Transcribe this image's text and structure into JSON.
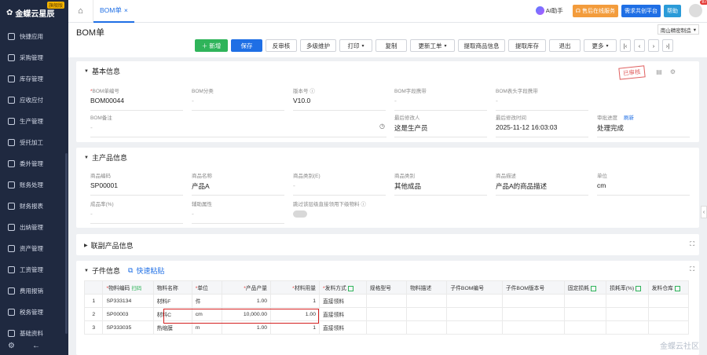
{
  "app": {
    "logo_text": "金蝶云星辰",
    "edition_badge": "旗舰版"
  },
  "sidebar": {
    "items": [
      {
        "label": "快捷应用"
      },
      {
        "label": "采购管理"
      },
      {
        "label": "库存管理"
      },
      {
        "label": "应收应付"
      },
      {
        "label": "生产管理"
      },
      {
        "label": "受托加工"
      },
      {
        "label": "委外管理"
      },
      {
        "label": "账务处理"
      },
      {
        "label": "财务报表"
      },
      {
        "label": "出纳管理"
      },
      {
        "label": "资产管理"
      },
      {
        "label": "工资管理"
      },
      {
        "label": "费用报销"
      },
      {
        "label": "税务管理"
      },
      {
        "label": "基础资料"
      }
    ]
  },
  "tabs": {
    "doc_tab": "BOM单"
  },
  "topbar": {
    "ai_label": "AI助手",
    "service_label": "售后在线服务",
    "demand_label": "需求共创平台",
    "help_label": "帮助",
    "notice_count": "87"
  },
  "page": {
    "title": "BOM单",
    "org": "南山精密制造"
  },
  "toolbar": {
    "new": "新增",
    "save": "保存",
    "unaudit": "反审核",
    "multi": "多级维护",
    "print": "打印",
    "copy": "复制",
    "update": "更新工单",
    "fetch_info": "提取商品信息",
    "fetch_stock": "提取库存",
    "exit": "退出",
    "more": "更多"
  },
  "basic": {
    "title": "基本信息",
    "stamp": "已审核",
    "bom_no_label": "BOM单编号",
    "bom_no": "BOM00044",
    "bom_cat_label": "BOM分类",
    "bom_cat": "-",
    "version_label": "版本号",
    "version": "V10.0",
    "field_carry_label": "BOM字段携带",
    "field_carry": "-",
    "head_carry_label": "BOM表头字段携带",
    "head_carry": "-",
    "remark_label": "BOM备注",
    "remark": "-",
    "modifier_label": "最后修改人",
    "modifier": "这是生产员",
    "modtime_label": "最后修改时间",
    "modtime": "2025-11-12 16:03:03",
    "approval_label": "审批进度",
    "refresh": "刷新",
    "approval": "处理完成"
  },
  "main_product": {
    "title": "主产品信息",
    "code_label": "商品编码",
    "code": "SP00001",
    "name_label": "商品名称",
    "name": "产品A",
    "cat_e_label": "商品类别(E)",
    "cat_e": "-",
    "cat_label": "商品类别",
    "cat": "其他成品",
    "desc_label": "商品描述",
    "desc": "产品A的商品描述",
    "unit_label": "单位",
    "unit": "cm",
    "yield_label": "成品率(%)",
    "yield": "-",
    "aux_label": "辅助属性",
    "aux": "-",
    "skip_label": "跳过该层级直接领用下级物料"
  },
  "co_product": {
    "title": "联副产品信息"
  },
  "sub": {
    "title": "子件信息",
    "paste": "快速粘贴",
    "headers": [
      "",
      "物料编码",
      "物料名称",
      "单位",
      "产品产量",
      "材料用量",
      "发料方式",
      "规格型号",
      "物料描述",
      "子件BOM编号",
      "子件BOM版本号",
      "固定损耗",
      "损耗率(%)",
      "发料仓库"
    ],
    "scan": "扫码",
    "rows": [
      {
        "no": "1",
        "code": "SP333134",
        "name": "材料F",
        "unit": "件",
        "output": "1.00",
        "usage": "1",
        "method": "直接领料"
      },
      {
        "no": "2",
        "code": "SP00003",
        "name": "材料C",
        "unit": "cm",
        "output": "10,000.00",
        "usage": "1.00",
        "method": "直接领料"
      },
      {
        "no": "3",
        "code": "SP333035",
        "name": "热缩膜",
        "unit": "m",
        "output": "1.00",
        "usage": "1",
        "method": "直接领料"
      }
    ]
  },
  "watermark": "金蝶云社区"
}
